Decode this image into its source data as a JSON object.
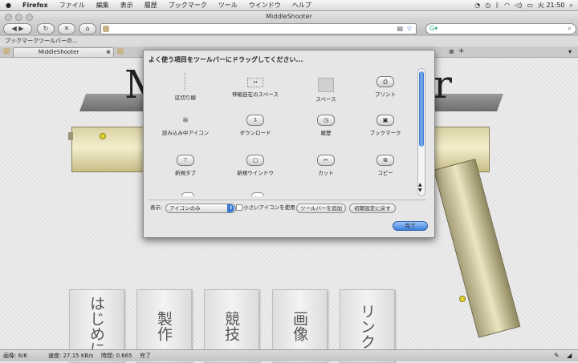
{
  "menubar": {
    "apple": "",
    "items": [
      "Firefox",
      "ファイル",
      "編集",
      "表示",
      "履歴",
      "ブックマーク",
      "ツール",
      "ウインドウ",
      "ヘルプ"
    ],
    "clock": "火 21:50"
  },
  "window": {
    "title": "MiddleShooter"
  },
  "bookmarks_bar": {
    "label": "ブックマークツールバーの..."
  },
  "tabs": [
    {
      "label": "MiddleShooter"
    }
  ],
  "page": {
    "nav": [
      "はじめに",
      "製作",
      "競技",
      "画像",
      "リンク"
    ],
    "logo_left": "M",
    "logo_right": "r"
  },
  "dialog": {
    "title": "よく使う項目をツールバーにドラッグしてください...",
    "items": [
      {
        "label": "区切り線"
      },
      {
        "label": "伸縮自在のスペース"
      },
      {
        "label": "スペース"
      },
      {
        "label": "プリント"
      },
      {
        "label": "読み込み中アイコン"
      },
      {
        "label": "ダウンロード"
      },
      {
        "label": "履歴"
      },
      {
        "label": "ブックマーク"
      },
      {
        "label": "新規タブ"
      },
      {
        "label": "新規ウインドウ"
      },
      {
        "label": "カット"
      },
      {
        "label": "コピー"
      }
    ],
    "show_label": "表示:",
    "show_value": "アイコンのみ",
    "small_icons_label": "小さいアイコンを使用",
    "add_toolbar_label": "ツールバーを追加",
    "restore_label": "初期設定に戻す",
    "done_label": "完了"
  },
  "statusbar": {
    "images": "画像: 6/6",
    "speed": "速度: 27.15 KB/s",
    "time": "時間: 0.665",
    "status": "完了"
  },
  "colors": {
    "accent": "#2d6fd0",
    "card_bg": "#efefef"
  }
}
